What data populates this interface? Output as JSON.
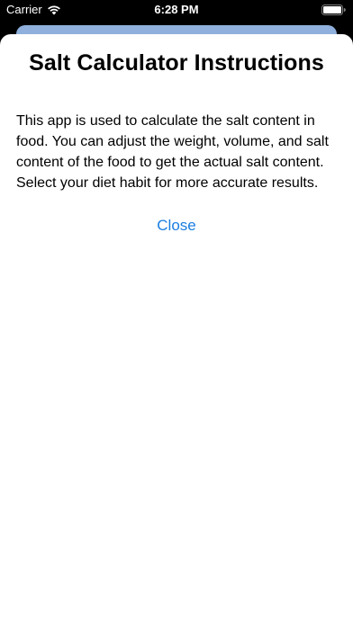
{
  "status_bar": {
    "carrier": "Carrier",
    "time": "6:28 PM"
  },
  "sheet": {
    "title": "Salt Calculator Instructions",
    "body": "This app is used to calculate the salt content in food. You can adjust the weight, volume, and salt content of the food to get the actual salt content. Select your diet habit for more accurate results.",
    "close_label": "Close"
  },
  "colors": {
    "accent": "#1a7ee0",
    "background_card": "#8fb0dc",
    "sheet_background": "#ffffff"
  },
  "icons": [
    "wifi-icon",
    "battery-icon"
  ]
}
